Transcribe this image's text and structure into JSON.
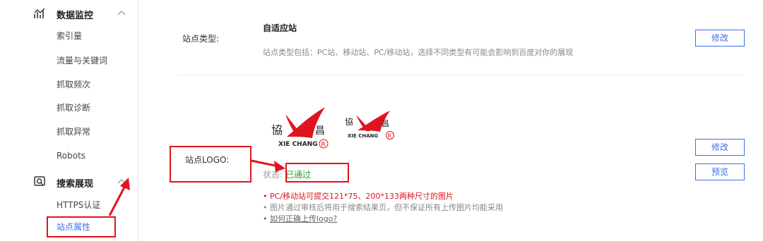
{
  "sidebar": {
    "groups": [
      {
        "label": "数据监控",
        "icon": "chart-trend-icon",
        "items": [
          "索引量",
          "流量与关键词",
          "抓取频次",
          "抓取诊断",
          "抓取异常",
          "Robots"
        ]
      },
      {
        "label": "搜索展现",
        "icon": "search-display-icon",
        "items": [
          "HTTPS认证",
          "站点属性"
        ]
      }
    ],
    "active_item": "站点属性"
  },
  "main": {
    "site_type": {
      "label": "站点类型:",
      "value": "自适应站",
      "description": "站点类型包括：PC站、移动站、PC/移动站，选择不同类型有可能会影响到百度对你的展现",
      "modify_label": "修改"
    },
    "site_logo": {
      "label": "站点LOGO:",
      "logo_text": {
        "left_char": "協",
        "right_char": "昌",
        "brand": "XIE CHANG",
        "mark": "R"
      },
      "status_label": "状态:",
      "status_value": "已通过",
      "modify_label": "修改",
      "preview_label": "预览",
      "notes": [
        "PC/移动站可提交121*75、200*133两种尺寸的图片",
        "图片通过审核后将用于搜索结果页，但不保证所有上传图片均能采用",
        "如何正确上传logo?"
      ]
    }
  },
  "colors": {
    "accent": "#3d6ee8",
    "annotation_red": "#e0141e",
    "status_green": "#2a9c2a"
  }
}
